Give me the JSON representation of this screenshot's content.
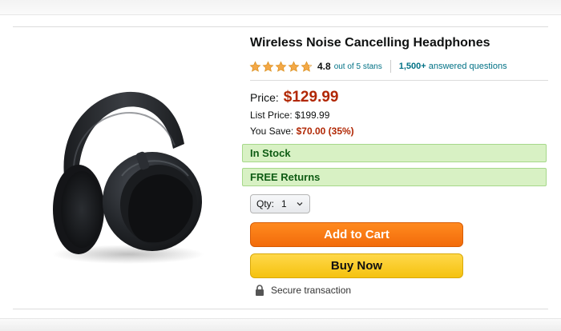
{
  "product": {
    "title": "Wireless Noise Cancelling Headphones",
    "image_alt": "Black over-ear headphones"
  },
  "rating": {
    "stars": 4.8,
    "value": "4.8",
    "out_of": "out of 5 stans",
    "answered_count": "1,500+",
    "answered_label": "answered questions"
  },
  "price": {
    "label": "Price:",
    "value": "$129.99",
    "list_label": "List Price:",
    "list_value": "$199.99",
    "save_label": "You Save:",
    "save_value": "$70.00 (35%)"
  },
  "availability": {
    "stock": "In Stock",
    "returns": "FREE Returns"
  },
  "quantity": {
    "label": "Qty:",
    "value": "1"
  },
  "actions": {
    "add_to_cart": "Add to Cart",
    "buy_now": "Buy Now"
  },
  "secure": {
    "label": "Secure transaction",
    "icon": "lock-icon"
  },
  "colors": {
    "price_red": "#b12704",
    "link_teal": "#007185",
    "star_gold": "#f3a847",
    "stock_green_bg": "#d8f1c4",
    "cart_orange": "#f26b0a",
    "buy_yellow": "#f5c20f"
  }
}
